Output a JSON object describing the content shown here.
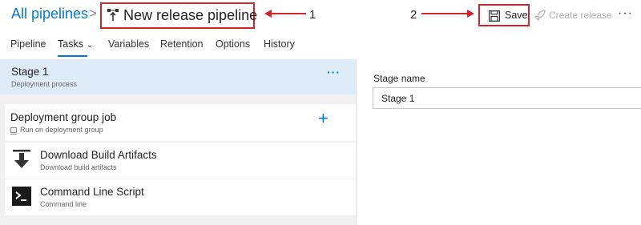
{
  "header": {
    "breadcrumb_root": "All pipelines",
    "breadcrumb_separator": ">",
    "pipeline_title": "New release pipeline",
    "save_label": "Save",
    "create_release_label": "Create release",
    "more_label": "···"
  },
  "annotations": {
    "label_1": "1",
    "label_2": "2",
    "color": "#d4242b"
  },
  "tabs": [
    {
      "label": "Pipeline"
    },
    {
      "label": "Tasks",
      "active": true
    },
    {
      "label": "Variables"
    },
    {
      "label": "Retention"
    },
    {
      "label": "Options"
    },
    {
      "label": "History"
    }
  ],
  "stage": {
    "title": "Stage 1",
    "subtitle": "Deployment process",
    "more_label": "···"
  },
  "job": {
    "title": "Deployment group job",
    "subtitle": "Run on deployment group",
    "add_label": "+"
  },
  "tasks": [
    {
      "title": "Download Build Artifacts",
      "subtitle": "Download build artifacts",
      "icon": "download-icon"
    },
    {
      "title": "Command Line Script",
      "subtitle": "Command line",
      "icon": "terminal-icon"
    }
  ],
  "stage_panel": {
    "field_label": "Stage name",
    "field_value": "Stage 1"
  },
  "colors": {
    "accent": "#0078d4",
    "selected_stage_bg": "#deecf9",
    "annotation": "#d4242b"
  }
}
